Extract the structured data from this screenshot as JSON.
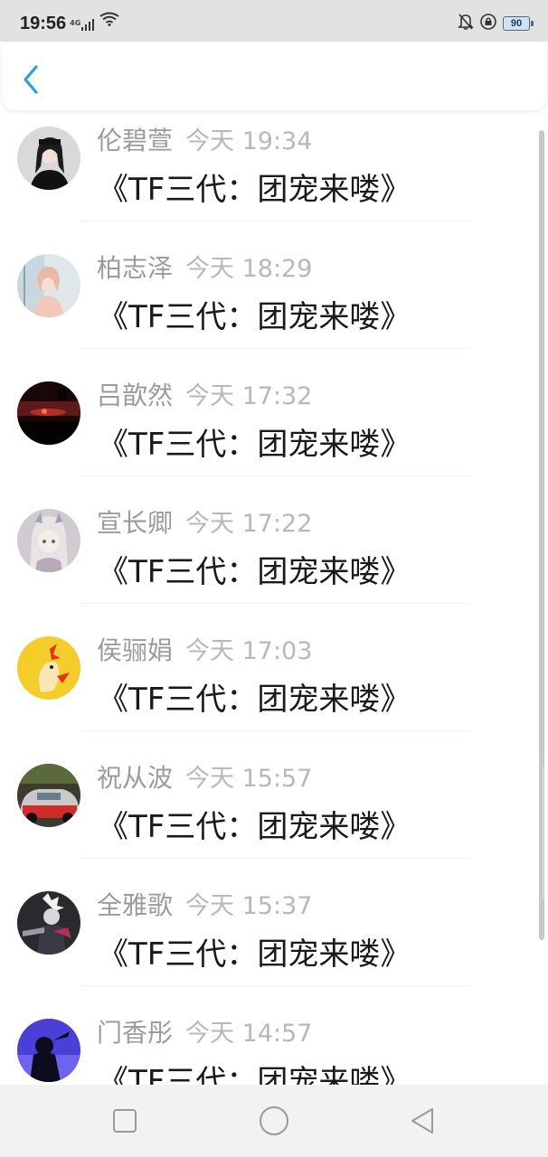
{
  "status_bar": {
    "time": "19:56",
    "network": "4G",
    "battery": "90",
    "icons": [
      "signal-icon",
      "wifi-icon",
      "mute-icon",
      "lock-rotation-icon",
      "battery-icon"
    ]
  },
  "header": {
    "back_icon": "chevron-left-icon",
    "accent": "#2aa0e6"
  },
  "messages": [
    {
      "name": "伦碧萱",
      "time": "今天 19:34",
      "title": "《TF三代：团宠来喽》"
    },
    {
      "name": "柏志泽",
      "time": "今天 18:29",
      "title": "《TF三代：团宠来喽》"
    },
    {
      "name": "吕歆然",
      "time": "今天 17:32",
      "title": "《TF三代：团宠来喽》"
    },
    {
      "name": "宣长卿",
      "time": "今天 17:22",
      "title": "《TF三代：团宠来喽》"
    },
    {
      "name": "侯骊娟",
      "time": "今天 17:03",
      "title": "《TF三代：团宠来喽》"
    },
    {
      "name": "祝从波",
      "time": "今天 15:57",
      "title": "《TF三代：团宠来喽》"
    },
    {
      "name": "全雅歌",
      "time": "今天 15:37",
      "title": "《TF三代：团宠来喽》"
    },
    {
      "name": "门香彤",
      "time": "今天 14:57",
      "title": "《TF三代：团宠来喽》"
    }
  ],
  "nav_bar": {
    "icons": [
      "square-recents-icon",
      "circle-home-icon",
      "triangle-back-icon"
    ]
  }
}
